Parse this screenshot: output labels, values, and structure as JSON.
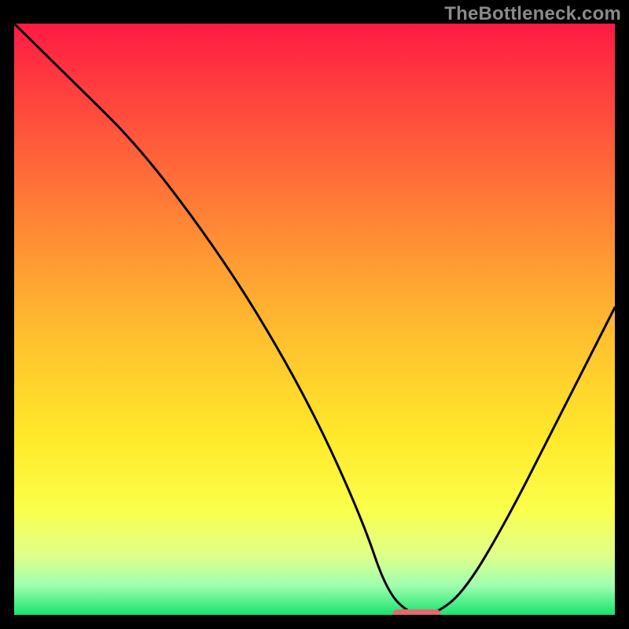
{
  "watermark": "TheBottleneck.com",
  "chart_data": {
    "type": "line",
    "title": "",
    "xlabel": "",
    "ylabel": "",
    "xlim": [
      0,
      100
    ],
    "ylim": [
      0,
      100
    ],
    "grid": false,
    "legend": false,
    "series": [
      {
        "name": "bottleneck-curve",
        "x": [
          0,
          10,
          20,
          30,
          40,
          50,
          58,
          62,
          66,
          70,
          75,
          82,
          90,
          100
        ],
        "y": [
          100,
          90,
          80,
          67,
          52,
          34,
          16,
          4,
          0,
          0,
          4,
          16,
          32,
          52
        ]
      }
    ],
    "marker": {
      "name": "optimal-point",
      "x_range": [
        63,
        71
      ],
      "y": 0,
      "color": "#e26a6f"
    },
    "background_gradient": {
      "stops": [
        {
          "pos": 0.0,
          "color": "#ff1a44"
        },
        {
          "pos": 0.1,
          "color": "#ff3b3f"
        },
        {
          "pos": 0.25,
          "color": "#ff6a39"
        },
        {
          "pos": 0.4,
          "color": "#ff9a33"
        },
        {
          "pos": 0.55,
          "color": "#ffc52e"
        },
        {
          "pos": 0.7,
          "color": "#ffe92a"
        },
        {
          "pos": 0.82,
          "color": "#fbff4a"
        },
        {
          "pos": 0.9,
          "color": "#e0ff8a"
        },
        {
          "pos": 0.95,
          "color": "#9fffb0"
        },
        {
          "pos": 1.0,
          "color": "#19e36e"
        }
      ]
    }
  }
}
